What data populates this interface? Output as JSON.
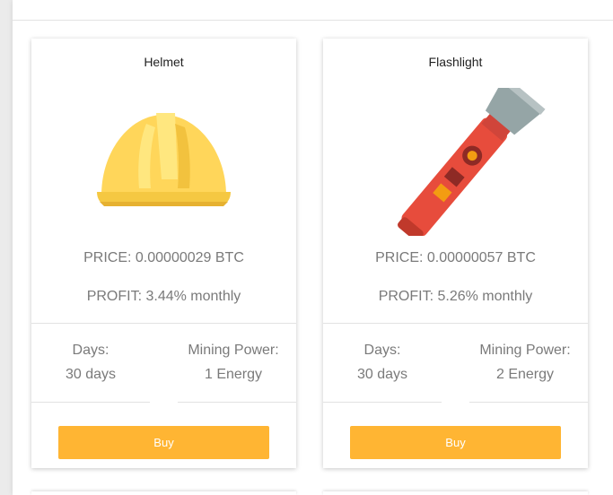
{
  "colors": {
    "accent": "#ffb533",
    "muted_text": "#7a7a7a"
  },
  "products": [
    {
      "title": "Helmet",
      "icon": "helmet-icon",
      "price": "PRICE: 0.00000029 BTC",
      "profit": "PROFIT: 3.44% monthly",
      "days_label": "Days:",
      "days_value": "30 days",
      "power_label": "Mining Power:",
      "power_value": "1 Energy",
      "buy_label": "Buy"
    },
    {
      "title": "Flashlight",
      "icon": "flashlight-icon",
      "price": "PRICE: 0.00000057 BTC",
      "profit": "PROFIT: 5.26% monthly",
      "days_label": "Days:",
      "days_value": "30 days",
      "power_label": "Mining Power:",
      "power_value": "2 Energy",
      "buy_label": "Buy"
    }
  ]
}
